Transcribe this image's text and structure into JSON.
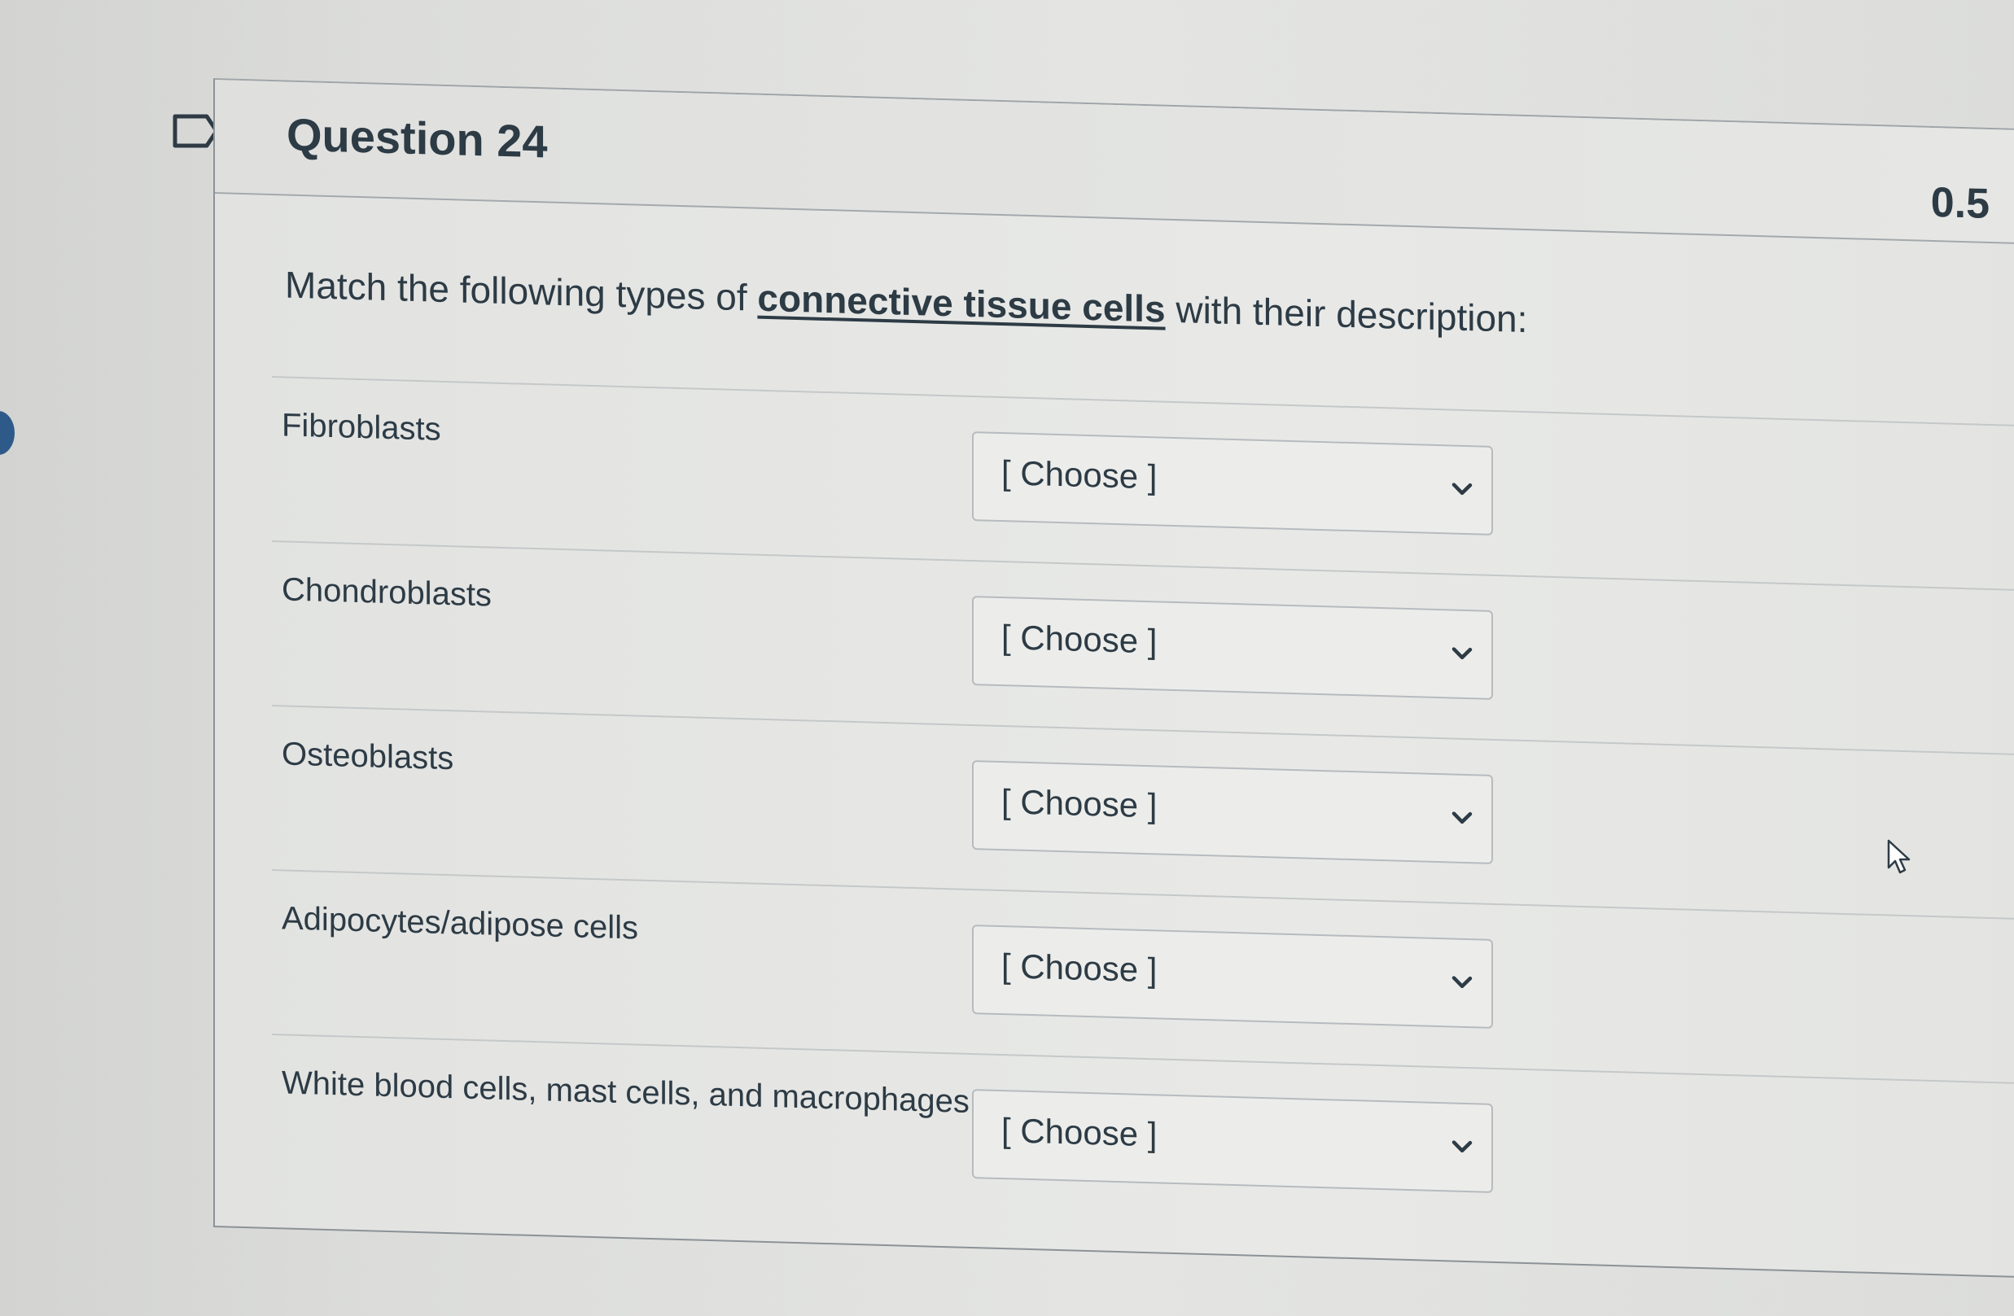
{
  "question": {
    "title": "Question 24",
    "points": "0.5",
    "prompt_before": "Match the following types of ",
    "prompt_emphasis": "connective tissue cells",
    "prompt_after": " with their description:"
  },
  "rows": [
    {
      "label": "Fibroblasts",
      "selected": "[ Choose ]"
    },
    {
      "label": "Chondroblasts",
      "selected": "[ Choose ]"
    },
    {
      "label": "Osteoblasts",
      "selected": "[ Choose ]"
    },
    {
      "label": "Adipocytes/adipose cells",
      "selected": "[ Choose ]"
    },
    {
      "label": "White blood cells, mast cells, and macrophages",
      "selected": "[ Choose ]"
    }
  ],
  "icons": {
    "flag": "flag-icon",
    "chevron": "chevron-down-icon",
    "cursor": "mouse-pointer-icon"
  },
  "colors": {
    "text": "#2d3b45",
    "accent": "#2e5a8a"
  }
}
